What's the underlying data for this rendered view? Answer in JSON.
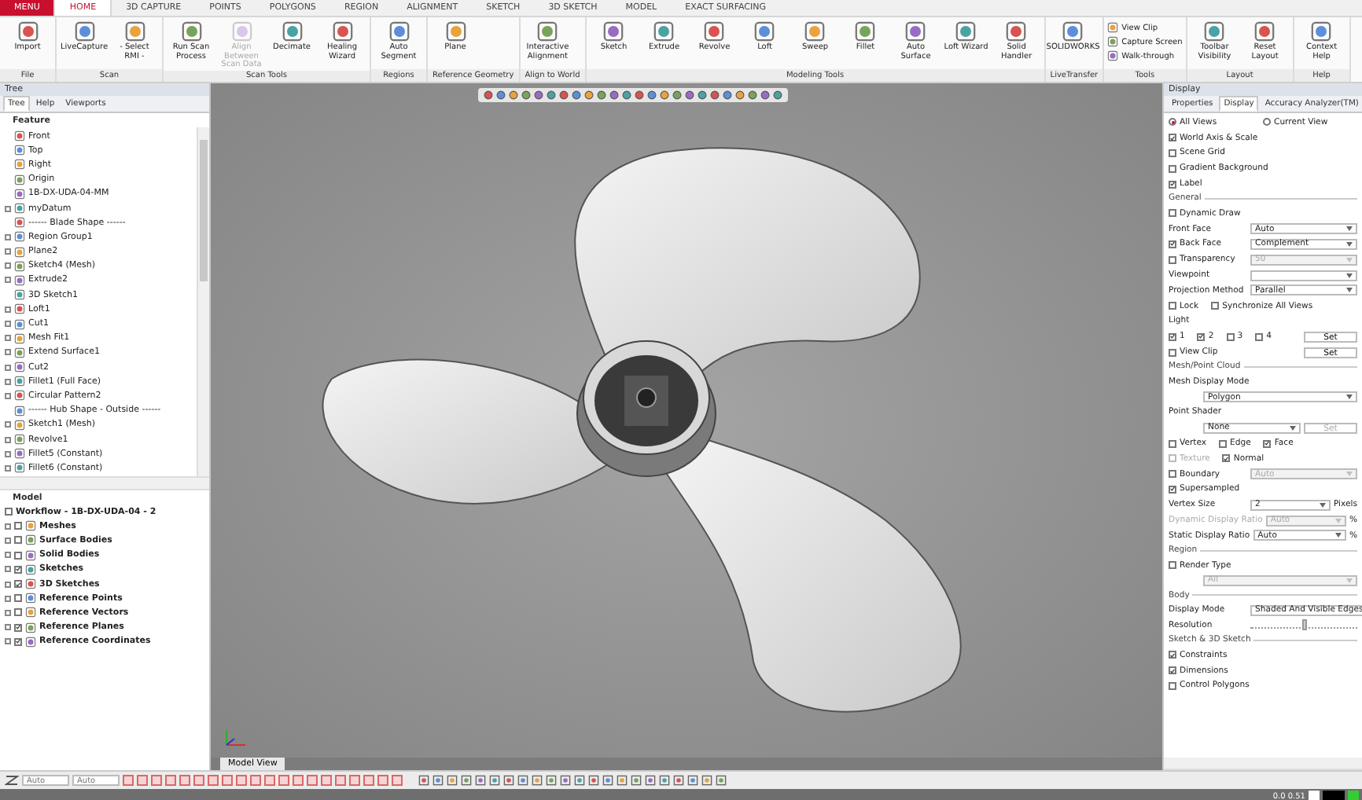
{
  "ribbon": {
    "tabs": [
      {
        "label": "MENU",
        "kind": "menu",
        "selected": false
      },
      {
        "label": "HOME",
        "kind": "tab",
        "selected": true
      },
      {
        "label": "3D CAPTURE",
        "kind": "tab",
        "selected": false
      },
      {
        "label": "POINTS",
        "kind": "tab",
        "selected": false
      },
      {
        "label": "POLYGONS",
        "kind": "tab",
        "selected": false
      },
      {
        "label": "REGION",
        "kind": "tab",
        "selected": false
      },
      {
        "label": "ALIGNMENT",
        "kind": "tab",
        "selected": false
      },
      {
        "label": "SKETCH",
        "kind": "tab",
        "selected": false
      },
      {
        "label": "3D SKETCH",
        "kind": "tab",
        "selected": false
      },
      {
        "label": "MODEL",
        "kind": "tab",
        "selected": false
      },
      {
        "label": "EXACT SURFACING",
        "kind": "tab",
        "selected": false
      }
    ],
    "groups": [
      {
        "label": "File",
        "buttons": [
          {
            "label": "Import",
            "kind": "large",
            "disabled": false
          }
        ]
      },
      {
        "label": "Scan",
        "buttons": [
          {
            "label": "LiveCapture",
            "kind": "large",
            "disabled": false
          },
          {
            "label": "- Select RMI -",
            "kind": "large",
            "disabled": false
          }
        ]
      },
      {
        "label": "Scan Tools",
        "buttons": [
          {
            "label": "Run Scan Process",
            "kind": "large",
            "disabled": false
          },
          {
            "label": "Align Between Scan Data",
            "kind": "large",
            "disabled": true
          },
          {
            "label": "Decimate",
            "kind": "large",
            "disabled": false
          },
          {
            "label": "Healing Wizard",
            "kind": "large",
            "disabled": false
          }
        ]
      },
      {
        "label": "Regions",
        "buttons": [
          {
            "label": "Auto Segment",
            "kind": "large",
            "disabled": false
          }
        ]
      },
      {
        "label": "Reference Geometry",
        "buttons": [
          {
            "label": "Plane",
            "kind": "large",
            "disabled": false
          }
        ]
      },
      {
        "label": "Align to World",
        "buttons": [
          {
            "label": "Interactive Alignment",
            "kind": "large",
            "disabled": false
          }
        ]
      },
      {
        "label": "Modeling Tools",
        "buttons": [
          {
            "label": "Sketch",
            "kind": "large",
            "disabled": false
          },
          {
            "label": "Extrude",
            "kind": "large",
            "disabled": false
          },
          {
            "label": "Revolve",
            "kind": "large",
            "disabled": false
          },
          {
            "label": "Loft",
            "kind": "large",
            "disabled": false
          },
          {
            "label": "Sweep",
            "kind": "large",
            "disabled": false
          },
          {
            "label": "Fillet",
            "kind": "large",
            "disabled": false
          },
          {
            "label": "Auto Surface",
            "kind": "large",
            "disabled": false
          },
          {
            "label": "Loft Wizard",
            "kind": "large",
            "disabled": false
          },
          {
            "label": "Solid Handler",
            "kind": "large",
            "disabled": false
          }
        ]
      },
      {
        "label": "LiveTransfer",
        "buttons": [
          {
            "label": "SOLIDWORKS",
            "kind": "large",
            "disabled": false
          }
        ]
      },
      {
        "label": "Tools",
        "buttons": [
          {
            "label": "View Clip",
            "kind": "small",
            "disabled": false
          },
          {
            "label": "Capture Screen",
            "kind": "small",
            "disabled": false
          },
          {
            "label": "Walk-through",
            "kind": "small",
            "disabled": false
          }
        ]
      },
      {
        "label": "Layout",
        "buttons": [
          {
            "label": "Toolbar Visibility",
            "kind": "large",
            "disabled": false
          },
          {
            "label": "Reset Layout",
            "kind": "large",
            "disabled": false
          }
        ]
      },
      {
        "label": "Help",
        "buttons": [
          {
            "label": "Context Help",
            "kind": "large",
            "disabled": false
          }
        ]
      }
    ]
  },
  "tree_panel": {
    "title": "Tree",
    "tabs": [
      {
        "label": "Tree",
        "selected": true
      },
      {
        "label": "Help",
        "selected": false
      },
      {
        "label": "Viewports",
        "selected": false
      }
    ],
    "feature_header": "Feature",
    "features": [
      {
        "label": "Front",
        "expandable": false
      },
      {
        "label": "Top",
        "expandable": false
      },
      {
        "label": "Right",
        "expandable": false
      },
      {
        "label": "Origin",
        "expandable": false
      },
      {
        "label": "1B-DX-UDA-04-MM",
        "expandable": false
      },
      {
        "label": "myDatum",
        "expandable": true
      },
      {
        "label": "------ Blade Shape ------",
        "expandable": false
      },
      {
        "label": "Region Group1",
        "expandable": true
      },
      {
        "label": "Plane2",
        "expandable": true
      },
      {
        "label": "Sketch4 (Mesh)",
        "expandable": true
      },
      {
        "label": "Extrude2",
        "expandable": true
      },
      {
        "label": "3D Sketch1",
        "expandable": false
      },
      {
        "label": "Loft1",
        "expandable": true
      },
      {
        "label": "Cut1",
        "expandable": true
      },
      {
        "label": "Mesh Fit1",
        "expandable": true
      },
      {
        "label": "Extend Surface1",
        "expandable": true
      },
      {
        "label": "Cut2",
        "expandable": true
      },
      {
        "label": "Fillet1 (Full Face)",
        "expandable": true
      },
      {
        "label": "Circular Pattern2",
        "expandable": true
      },
      {
        "label": "------ Hub Shape - Outside ------",
        "expandable": false
      },
      {
        "label": "Sketch1 (Mesh)",
        "expandable": true
      },
      {
        "label": "Revolve1",
        "expandable": true
      },
      {
        "label": "Fillet5 (Constant)",
        "expandable": true
      },
      {
        "label": "Fillet6 (Constant)",
        "expandable": true
      }
    ],
    "model_header": "Model",
    "workflow": "Workflow - 1B-DX-UDA-04 - 2",
    "model_items": [
      {
        "label": "Meshes",
        "visible": false
      },
      {
        "label": "Surface Bodies",
        "visible": false
      },
      {
        "label": "Solid Bodies",
        "visible": false
      },
      {
        "label": "Sketches",
        "visible": true
      },
      {
        "label": "3D Sketches",
        "visible": true
      },
      {
        "label": "Reference Points",
        "visible": false
      },
      {
        "label": "Reference Vectors",
        "visible": false
      },
      {
        "label": "Reference Planes",
        "visible": true
      },
      {
        "label": "Reference Coordinates",
        "visible": true
      }
    ]
  },
  "viewport": {
    "tab": "Model View"
  },
  "display_panel": {
    "title": "Display",
    "tabs": [
      {
        "label": "Properties",
        "selected": false
      },
      {
        "label": "Display",
        "selected": true
      },
      {
        "label": "Accuracy Analyzer(TM)",
        "selected": false
      }
    ],
    "rows": [
      {
        "kind": "radios",
        "options": [
          {
            "label": "All Views",
            "selected": true
          },
          {
            "label": "Current View",
            "selected": false
          }
        ]
      },
      {
        "kind": "check",
        "label": "World Axis & Scale",
        "checked": true
      },
      {
        "kind": "check",
        "label": "Scene Grid",
        "checked": false
      },
      {
        "kind": "check",
        "label": "Gradient Background",
        "checked": false
      },
      {
        "kind": "check",
        "label": "Label",
        "checked": true
      },
      {
        "kind": "section",
        "label": "General"
      },
      {
        "kind": "check",
        "label": "Dynamic Draw",
        "checked": false
      },
      {
        "kind": "field",
        "label": "Front Face",
        "value": "Auto",
        "disabled": false
      },
      {
        "kind": "field",
        "label": "Back Face",
        "checked": true,
        "value": "Complement",
        "disabled": false
      },
      {
        "kind": "field",
        "label": "Transparency",
        "checked": false,
        "value": "50",
        "disabled": true
      },
      {
        "kind": "field",
        "label": "Viewpoint",
        "disabled": false
      },
      {
        "kind": "field",
        "label": "Projection Method",
        "value": "Parallel",
        "disabled": false
      },
      {
        "kind": "checks",
        "items": [
          {
            "label": "Lock",
            "checked": false,
            "disabled": false
          },
          {
            "label": "Synchronize All Views",
            "checked": false,
            "disabled": false
          }
        ]
      },
      {
        "kind": "label",
        "label": "Light"
      },
      {
        "kind": "checks",
        "items": [
          {
            "label": "1",
            "checked": true,
            "disabled": false
          },
          {
            "label": "2",
            "checked": true,
            "disabled": false
          },
          {
            "label": "3",
            "checked": false,
            "disabled": false
          },
          {
            "label": "4",
            "checked": false,
            "disabled": false
          }
        ],
        "button": "Set"
      },
      {
        "kind": "checks",
        "items": [
          {
            "label": "View Clip",
            "checked": false,
            "disabled": false
          }
        ],
        "button": "Set"
      },
      {
        "kind": "section",
        "label": "Mesh/Point Cloud"
      },
      {
        "kind": "label",
        "label": "Mesh Display Mode"
      },
      {
        "kind": "field",
        "value": "Polygon",
        "disabled": false
      },
      {
        "kind": "label",
        "label": "Point Shader"
      },
      {
        "kind": "field",
        "value": "None",
        "disabled": false,
        "button": "Set"
      },
      {
        "kind": "checks",
        "items": [
          {
            "label": "Vertex",
            "checked": false,
            "disabled": false
          },
          {
            "label": "Edge",
            "checked": false,
            "disabled": false
          },
          {
            "label": "Face",
            "checked": true,
            "disabled": false
          }
        ]
      },
      {
        "kind": "checks",
        "items": [
          {
            "label": "Texture",
            "checked": false,
            "disabled": true
          },
          {
            "label": "Normal",
            "checked": true,
            "disabled": false
          }
        ]
      },
      {
        "kind": "field",
        "label": "Boundary",
        "checked": false,
        "value": "Auto",
        "disabled": true
      },
      {
        "kind": "check",
        "label": "Supersampled",
        "checked": true
      },
      {
        "kind": "field",
        "label": "Vertex Size",
        "value": "2",
        "unit": "Pixels",
        "disabled": false
      },
      {
        "kind": "field",
        "label": "Dynamic Display Ratio",
        "value": "Auto",
        "unit": "%",
        "disabled": true
      },
      {
        "kind": "field",
        "label": "Static Display Ratio",
        "value": "Auto",
        "unit": "%",
        "disabled": false
      },
      {
        "kind": "section",
        "label": "Region"
      },
      {
        "kind": "check",
        "label": "Render Type",
        "checked": false
      },
      {
        "kind": "field",
        "value": "All",
        "disabled": true
      },
      {
        "kind": "section",
        "label": "Body"
      },
      {
        "kind": "field",
        "label": "Display Mode",
        "value": "Shaded And Visible Edges",
        "disabled": false
      },
      {
        "kind": "slider",
        "label": "Resolution",
        "level": 0.5
      },
      {
        "kind": "section",
        "label": "Sketch & 3D Sketch"
      },
      {
        "kind": "check",
        "label": "Constraints",
        "checked": true
      },
      {
        "kind": "check",
        "label": "Dimensions",
        "checked": true
      },
      {
        "kind": "check",
        "label": "Control Polygons",
        "checked": false
      }
    ]
  },
  "status_bar": {
    "selects": [
      "Auto",
      "Auto"
    ],
    "reading": "0.0 0.51"
  }
}
